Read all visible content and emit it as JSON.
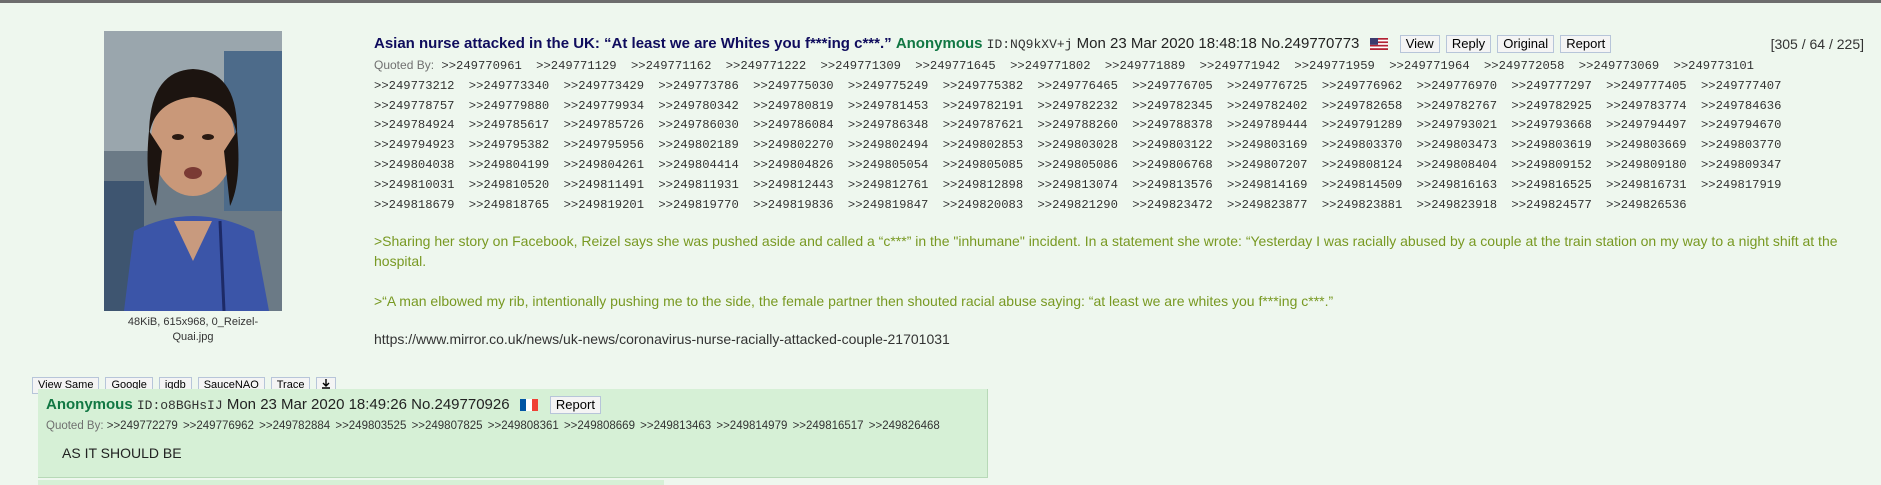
{
  "op": {
    "file": {
      "info_line1": "48KiB, 615x968, 0_Reizel-",
      "info_line2": "Quai.jpg"
    },
    "search_buttons": [
      "View Same",
      "Google",
      "iqdb",
      "SauceNAO",
      "Trace"
    ],
    "download_icon": "download-icon",
    "subject": "Asian nurse attacked in the UK: “At least we are Whites you f***ing c***.”",
    "name": "Anonymous",
    "poster_id": "ID:NQ9kXV+j",
    "date": "Mon 23 Mar 2020 18:48:18",
    "post_no": "No.249770773",
    "flag": "us-flag",
    "buttons": [
      "View",
      "Reply",
      "Original",
      "Report"
    ],
    "counter": "[305 / 64 / 225]",
    "quoted_by_label": "Quoted By:",
    "quoted_by": [
      ">>249770961",
      ">>249771129",
      ">>249771162",
      ">>249771222",
      ">>249771309",
      ">>249771645",
      ">>249771802",
      ">>249771889",
      ">>249771942",
      ">>249771959",
      ">>249771964",
      ">>249772058",
      ">>249773069",
      ">>249773101",
      ">>249773212",
      ">>249773340",
      ">>249773429",
      ">>249773786",
      ">>249775030",
      ">>249775249",
      ">>249775382",
      ">>249776465",
      ">>249776705",
      ">>249776725",
      ">>249776962",
      ">>249776970",
      ">>249777297",
      ">>249777405",
      ">>249777407",
      ">>249778757",
      ">>249779880",
      ">>249779934",
      ">>249780342",
      ">>249780819",
      ">>249781453",
      ">>249782191",
      ">>249782232",
      ">>249782345",
      ">>249782402",
      ">>249782658",
      ">>249782767",
      ">>249782925",
      ">>249783774",
      ">>249784636",
      ">>249784924",
      ">>249785617",
      ">>249785726",
      ">>249786030",
      ">>249786084",
      ">>249786348",
      ">>249787621",
      ">>249788260",
      ">>249788378",
      ">>249789444",
      ">>249791289",
      ">>249793021",
      ">>249793668",
      ">>249794497",
      ">>249794670",
      ">>249794923",
      ">>249795382",
      ">>249795956",
      ">>249802189",
      ">>249802270",
      ">>249802494",
      ">>249802853",
      ">>249803028",
      ">>249803122",
      ">>249803169",
      ">>249803370",
      ">>249803473",
      ">>249803619",
      ">>249803669",
      ">>249803770",
      ">>249804038",
      ">>249804199",
      ">>249804261",
      ">>249804414",
      ">>249804826",
      ">>249805054",
      ">>249805085",
      ">>249805086",
      ">>249806768",
      ">>249807207",
      ">>249808124",
      ">>249808404",
      ">>249809152",
      ">>249809180",
      ">>249809347",
      ">>249810031",
      ">>249810520",
      ">>249811491",
      ">>249811931",
      ">>249812443",
      ">>249812761",
      ">>249812898",
      ">>249813074",
      ">>249813576",
      ">>249814169",
      ">>249814509",
      ">>249816163",
      ">>249816525",
      ">>249816731",
      ">>249817919",
      ">>249818679",
      ">>249818765",
      ">>249819201",
      ">>249819770",
      ">>249819836",
      ">>249819847",
      ">>249820083",
      ">>249821290",
      ">>249823472",
      ">>249823877",
      ">>249823881",
      ">>249823918",
      ">>249824577",
      ">>249826536"
    ],
    "greentext": [
      ">Sharing her story on Facebook, Reizel says she was pushed aside and called a “c***” in the \"inhumane\" incident. In a statement she wrote: “Yesterday I was racially abused by a couple at the train station on my way to a night shift at the hospital.",
      ">“A man elbowed my rib, intentionally pushing me to the side, the female partner then shouted racial abuse saying: “at least we are whites you f***ing c***.”"
    ],
    "link": "https://www.mirror.co.uk/news/uk-news/coronavirus-nurse-racially-attacked-couple-21701031"
  },
  "reply": {
    "name": "Anonymous",
    "poster_id": "ID:o8BGHsIJ",
    "date": "Mon 23 Mar 2020 18:49:26",
    "post_no": "No.249770926",
    "flag": "fr-flag",
    "report_label": "Report",
    "quoted_by_label": "Quoted By:",
    "quoted_by": [
      ">>249772279",
      ">>249776962",
      ">>249782884",
      ">>249803525",
      ">>249807825",
      ">>249808361",
      ">>249808669",
      ">>249813463",
      ">>249814979",
      ">>249816517",
      ">>249826468"
    ],
    "text": "AS IT SHOULD BE"
  },
  "colors": {
    "background": "#eef7ee",
    "subject": "#0f0c5d",
    "name": "#117743",
    "greentext": "#789922",
    "reply_bg": "#d6f0d6"
  }
}
